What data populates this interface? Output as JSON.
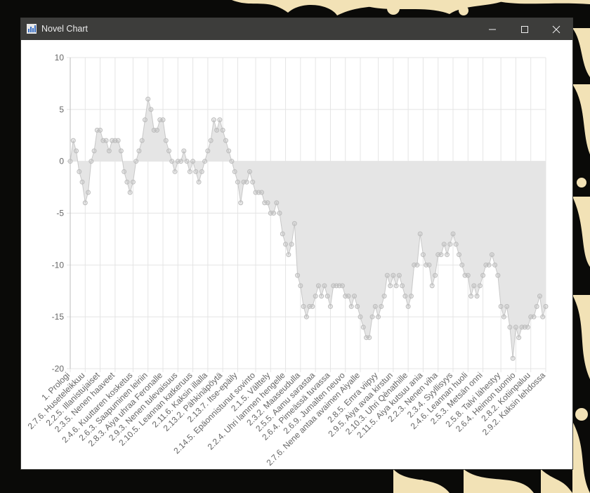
{
  "window": {
    "title": "Novel Chart",
    "icon": "bar-chart-icon",
    "controls": [
      "minimize-icon",
      "maximize-icon",
      "close-icon"
    ]
  },
  "colors": {
    "titlebar": "#3d3d3b",
    "title_text": "#ececec",
    "area_fill": "#e5e5e5",
    "line": "#c8c8c8",
    "point": "#bdbdbd",
    "grid": "#e4e4e4",
    "axis_text": "#666666",
    "background_pattern": "#f2e2b6"
  },
  "chart_data": {
    "type": "area",
    "title": "",
    "xlabel": "",
    "ylabel": "",
    "ylim": [
      -20,
      10
    ],
    "yticks": [
      10,
      5,
      0,
      -5,
      -10,
      -15,
      -20
    ],
    "grid": true,
    "legend": "none",
    "x_labels": [
      "1. Prologi",
      "2.7.6. Huseteleikkuu",
      "2.2.5. Illanistujaiset",
      "2.3.5. Nenen haaveet",
      "2.4.6. Kuuttaren kosketus",
      "2.6.3. Saapuminen leiriin",
      "2.8.3. Aiya uhraa Feronalle",
      "2.9.3. Nenen tulevaisuus",
      "2.10.5. Leannan katkeruus",
      "2.11.6. Kaksin illalla",
      "2.13.2. Pähkinäpöytä",
      "2.13.7. Itse-epäily",
      "2.14.5. Epäonnistunut sovinto",
      "2.1.5. Välttely",
      "2.2.4. Uhri lammen hengelle",
      "2.3.2. Maaseudulla",
      "2.5.5. Aamu sarastaa",
      "2.6.4. Pimeässä tuvassa",
      "2.6.9. Jumalten neuvo",
      "2.7.6. Nene antaa avaimen Aiyalle",
      "2.8.5. Emra viipyy",
      "2.9.5. Aiya avaa kirstun",
      "2.10.3. Uhri Qènathille",
      "2.11.5. Aiya kutsuu ania",
      "2.2.3. Nenen viha",
      "2.3.4. Syyllisyys",
      "2.4.6. Leannan huoli",
      "2.5.3. Metsän onni",
      "2.5.8. Talvi lähestyy",
      "2.6.4. Heimon tuomio",
      "2.8.2. Kotiinpaluu",
      "2.9.2. Kaksin lehdossa"
    ],
    "values": [
      0,
      2,
      1,
      -1,
      -2,
      -4,
      -3,
      0,
      1,
      3,
      3,
      2,
      2,
      1,
      2,
      2,
      2,
      1,
      -1,
      -2,
      -3,
      -2,
      0,
      1,
      2,
      4,
      6,
      5,
      3,
      3,
      4,
      4,
      2,
      1,
      0,
      -1,
      0,
      0,
      1,
      0,
      -1,
      0,
      -1,
      -2,
      -1,
      0,
      1,
      2,
      4,
      3,
      4,
      3,
      2,
      1,
      0,
      -1,
      -2,
      -4,
      -2,
      -2,
      -1,
      -2,
      -3,
      -3,
      -3,
      -4,
      -4,
      -5,
      -5,
      -4,
      -5,
      -7,
      -8,
      -9,
      -8,
      -6,
      -11,
      -12,
      -14,
      -15,
      -14,
      -14,
      -13,
      -12,
      -13,
      -12,
      -13,
      -14,
      -12,
      -12,
      -12,
      -12,
      -13,
      -13,
      -14,
      -13,
      -14,
      -15,
      -16,
      -17,
      -17,
      -15,
      -14,
      -15,
      -14,
      -13,
      -11,
      -12,
      -11,
      -12,
      -11,
      -12,
      -13,
      -14,
      -13,
      -10,
      -10,
      -7,
      -9,
      -10,
      -10,
      -12,
      -11,
      -9,
      -9,
      -8,
      -9,
      -8,
      -7,
      -8,
      -9,
      -10,
      -11,
      -11,
      -13,
      -12,
      -13,
      -12,
      -11,
      -10,
      -10,
      -9,
      -10,
      -11,
      -14,
      -15,
      -14,
      -16,
      -19,
      -16,
      -17,
      -16,
      -16,
      -16,
      -15,
      -15,
      -14,
      -13,
      -15,
      -14
    ]
  }
}
